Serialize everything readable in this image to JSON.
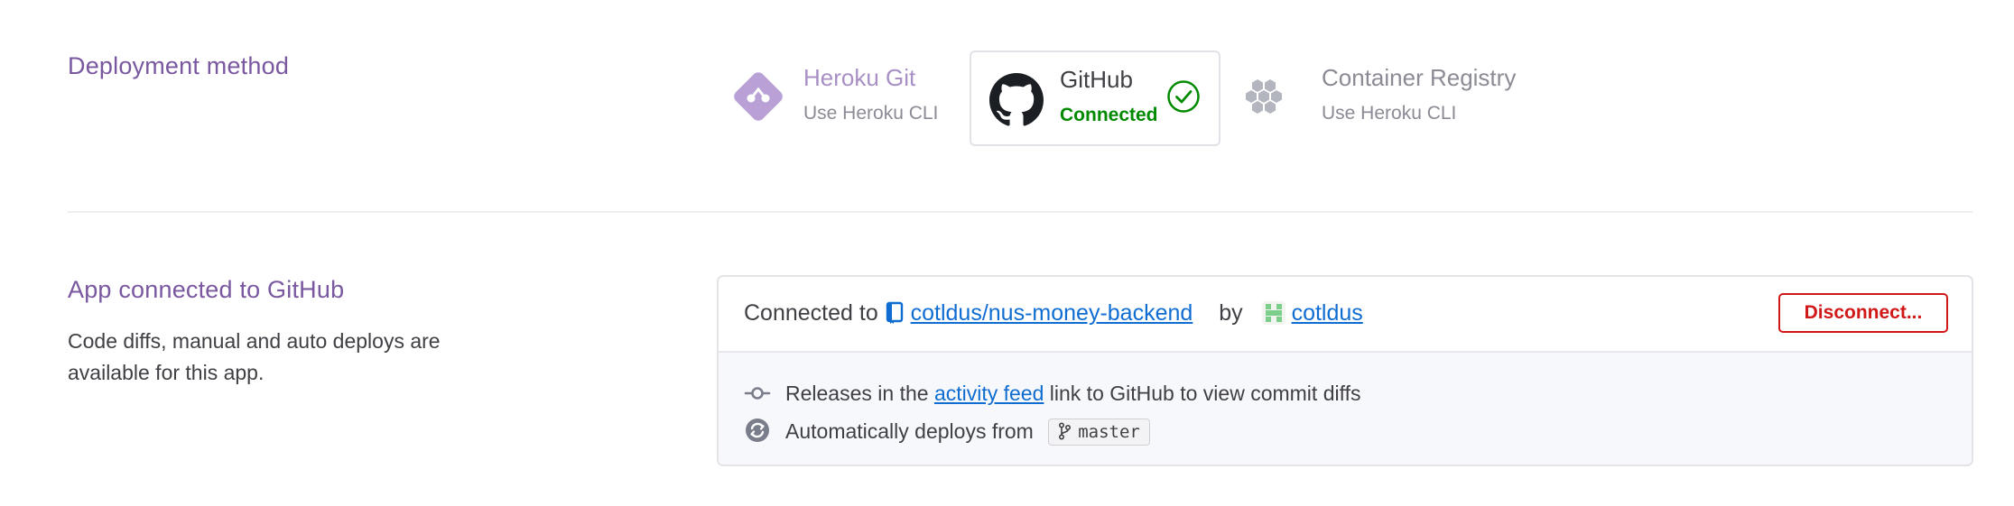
{
  "deployment": {
    "title": "Deployment method",
    "methods": [
      {
        "name": "Heroku Git",
        "sub": "Use Heroku CLI",
        "icon": "heroku-git-icon",
        "selected": false
      },
      {
        "name": "GitHub",
        "sub": "Connected",
        "icon": "github-icon",
        "selected": true,
        "status_icon": "check-circle-icon"
      },
      {
        "name": "Container Registry",
        "sub": "Use Heroku CLI",
        "icon": "container-registry-icon",
        "selected": false
      }
    ]
  },
  "connected": {
    "title": "App connected to GitHub",
    "description": "Code diffs, manual and auto deploys are available for this app.",
    "connected_to_label": "Connected to",
    "repo": "cotldus/nus-money-backend",
    "by_label": "by",
    "user": "cotldus",
    "disconnect_label": "Disconnect...",
    "releases_prefix": "Releases in the",
    "releases_link": "activity feed",
    "releases_suffix": "link to GitHub to view commit diffs",
    "auto_deploy_label": "Automatically deploys from",
    "branch": "master"
  },
  "colors": {
    "accent_purple": "#79589f",
    "connected_green": "#008a00",
    "link_blue": "#0f6dd2",
    "danger_red": "#d01818"
  }
}
